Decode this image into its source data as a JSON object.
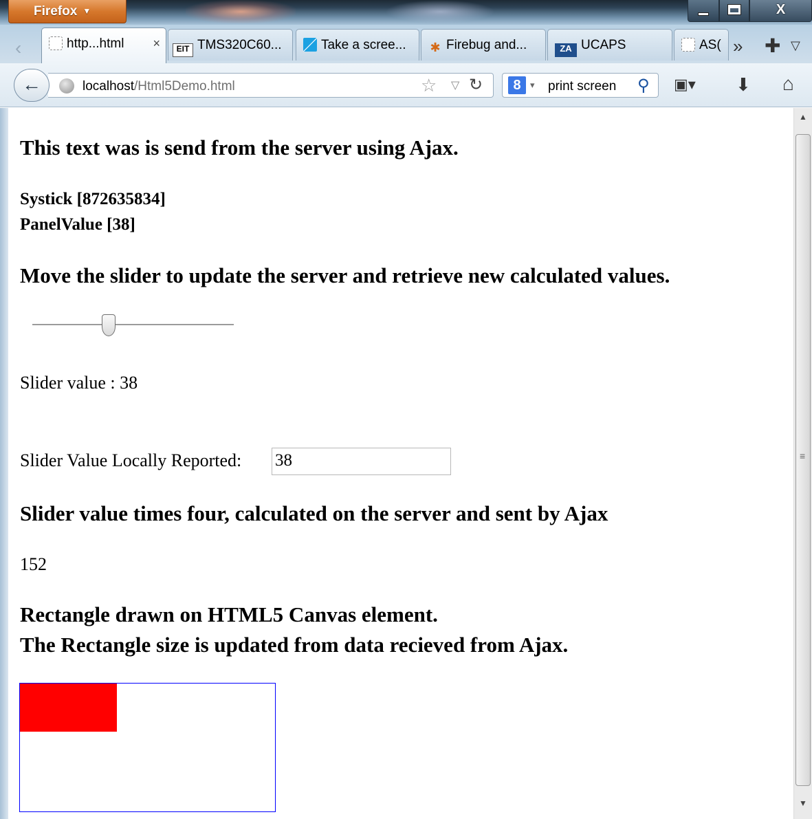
{
  "window": {
    "app_menu_label": "Firefox",
    "minimize_glyph": "▁",
    "maximize_glyph": "□",
    "close_glyph": "X"
  },
  "tabs": [
    {
      "label": "http...html",
      "icon": "blank-page-icon",
      "active": true
    },
    {
      "label": "TMS320C60...",
      "icon": "eit-icon",
      "icon_text": "EIT"
    },
    {
      "label": "Take a scree...",
      "icon": "windows-icon"
    },
    {
      "label": "Firebug and...",
      "icon": "firebug-icon"
    },
    {
      "label": "UCAPS",
      "icon": "ucaps-icon",
      "icon_text": "ZA"
    },
    {
      "label": "AS(",
      "icon": "blank-page-icon"
    }
  ],
  "navbar": {
    "url_host": "localhost",
    "url_path": "/Html5Demo.html",
    "search_engine_letter": "8",
    "search_text": "print screen"
  },
  "content": {
    "intro_heading": "This text was is send from the server using Ajax.",
    "systick_line": "Systick [872635834]",
    "panelvalue_line": "PanelValue [38]",
    "slider_heading": "Move the slider to update the server and retrieve new calculated values.",
    "slider": {
      "value": 38,
      "min": 0,
      "max": 100
    },
    "slider_value_text": "Slider value : 38",
    "local_label": "Slider Value Locally Reported:",
    "local_value": "38",
    "times_four_heading": "Slider value times four, calculated on the server and sent by Ajax",
    "times_four_value": "152",
    "canvas_heading_1": "Rectangle drawn on HTML5 Canvas element.",
    "canvas_heading_2": "The Rectangle size is updated from data recieved from Ajax.",
    "canvas_rect_fill": 0.38
  },
  "colors": {
    "canvas_border": "#0000ff",
    "rect_fill": "#ff0000",
    "firefox_orange": "#d6782c"
  }
}
